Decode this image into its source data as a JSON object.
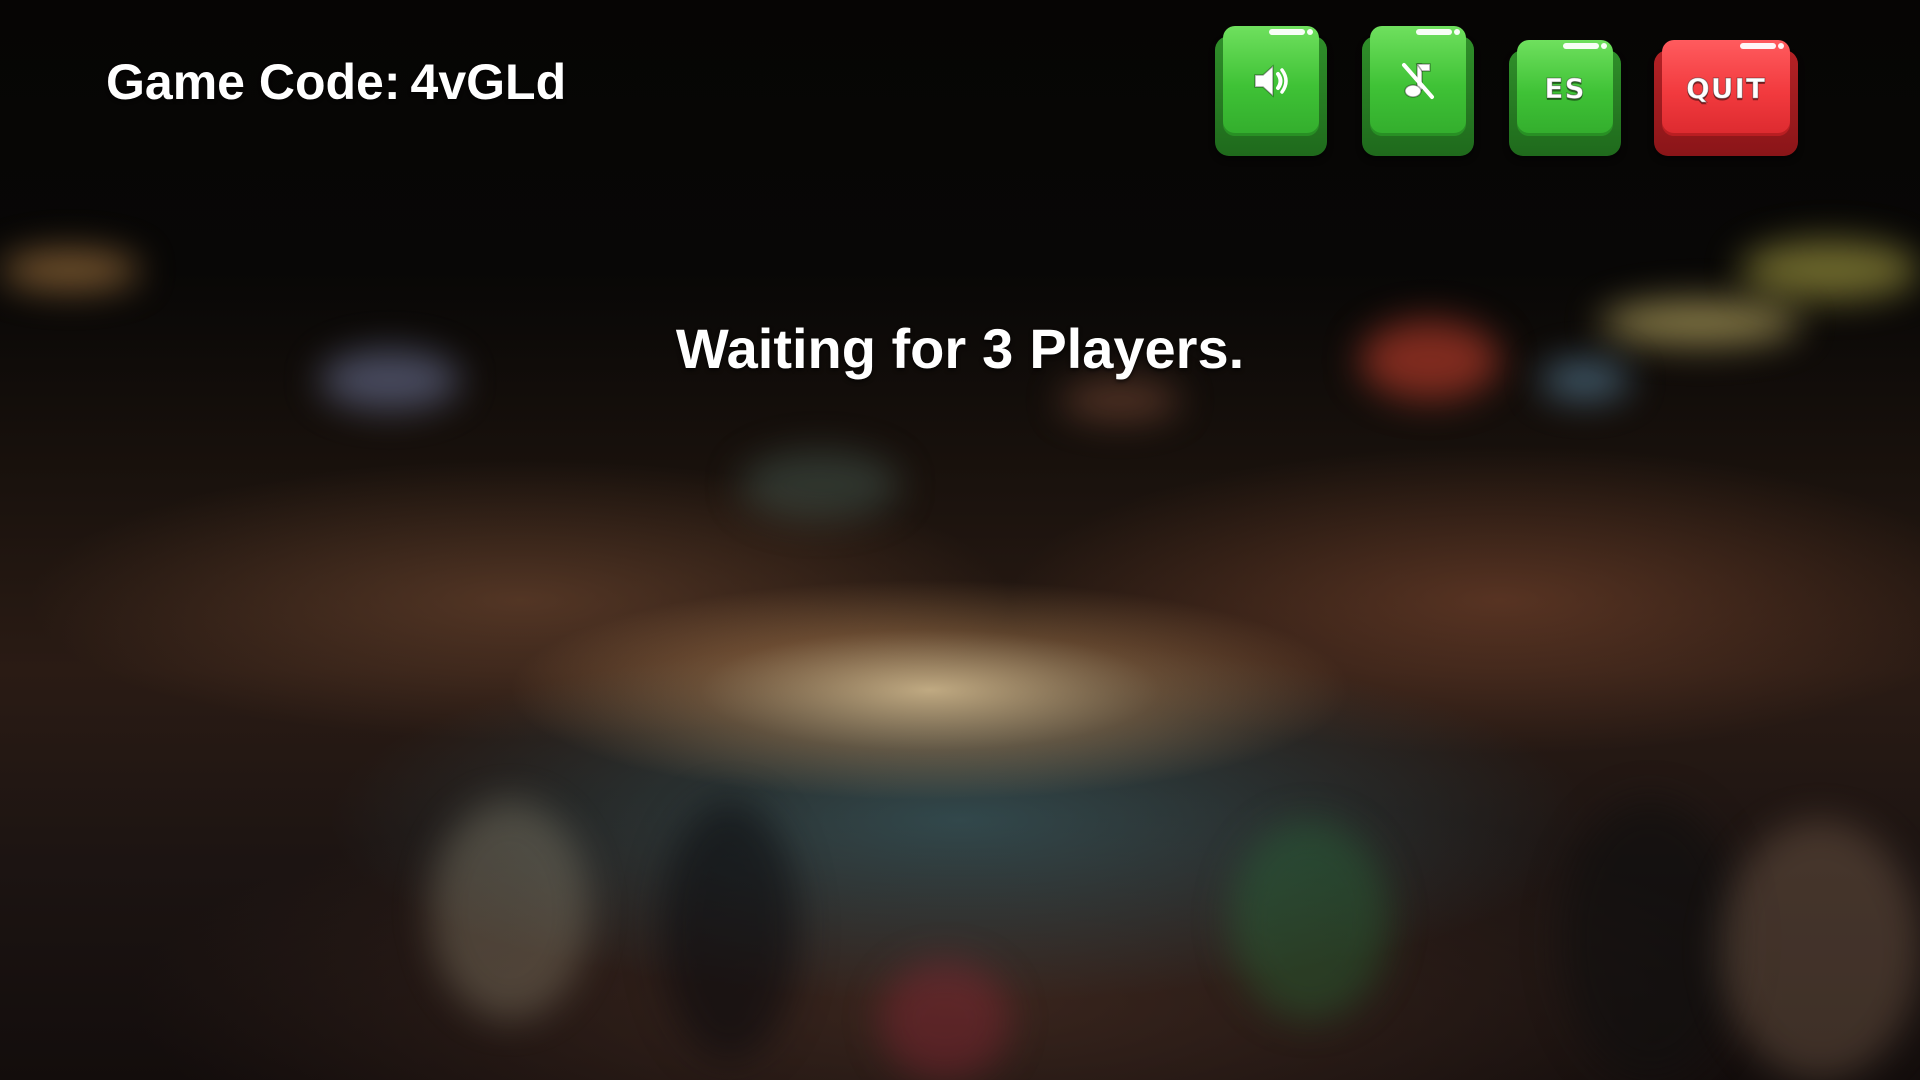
{
  "game": {
    "code_label": "Game Code:",
    "code_value": "4vGLd"
  },
  "status": {
    "lead": "Waiting for",
    "player_count": "3",
    "suffix": "Players."
  },
  "controls": {
    "sound_icon": "speaker-icon",
    "music_icon": "music-off-icon",
    "language_label": "ES",
    "quit_label": "QUIT"
  },
  "colors": {
    "button_green": "#3fc236",
    "button_red": "#f23a3e",
    "text": "#ffffff"
  }
}
